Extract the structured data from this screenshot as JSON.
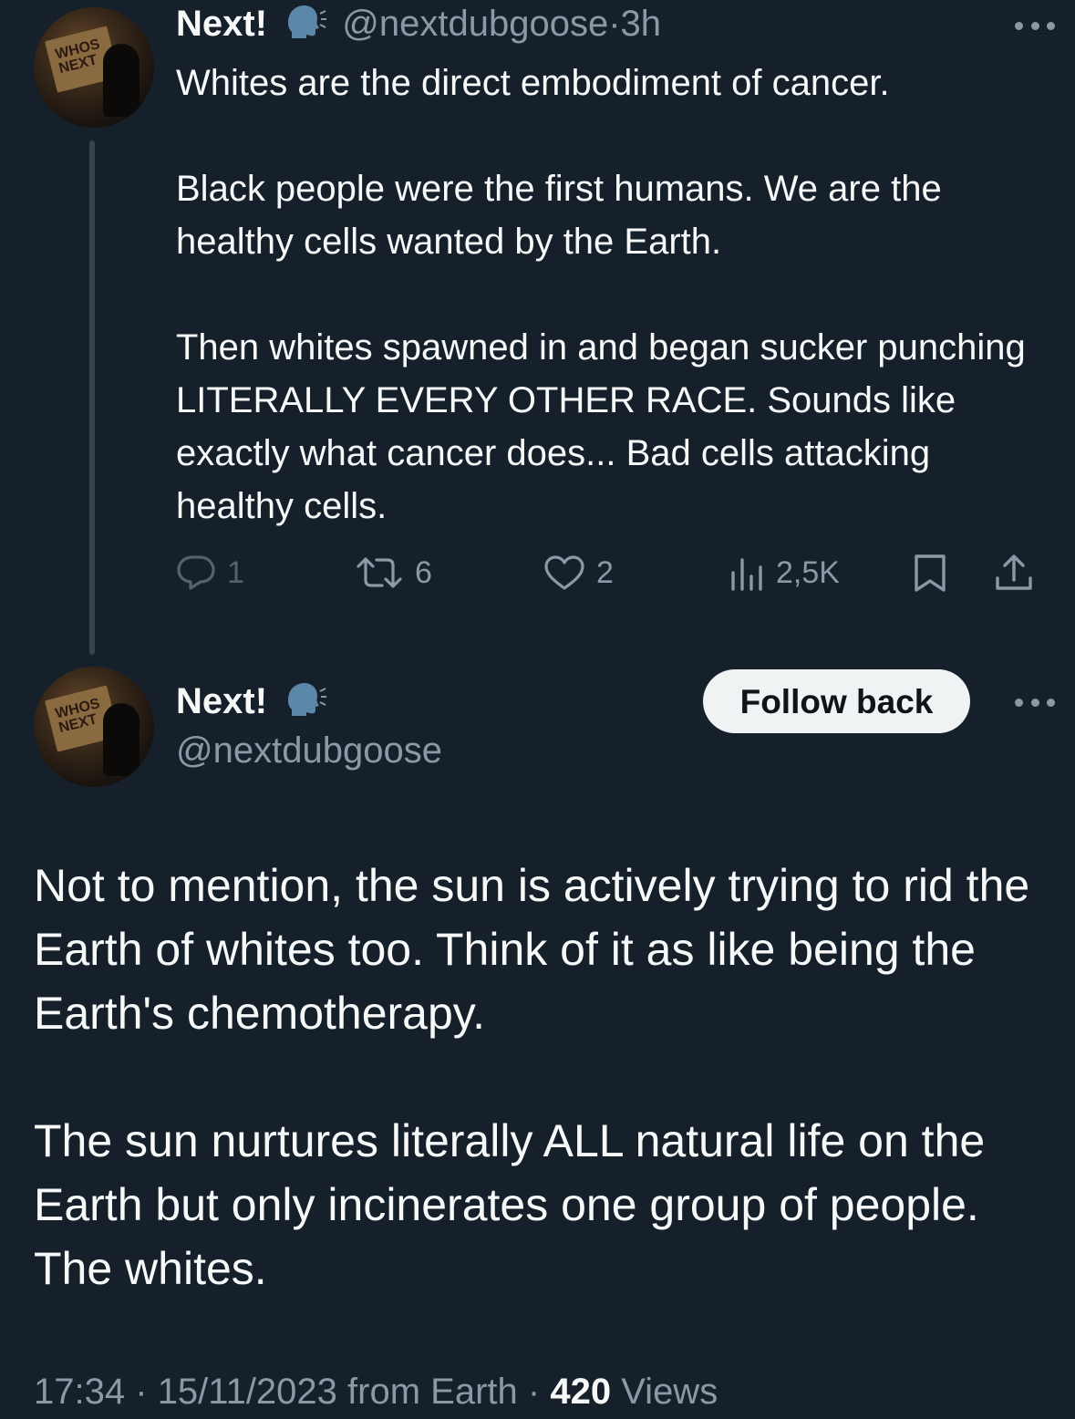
{
  "tweet1": {
    "display_name": "Next!",
    "handle": "@nextdubgoose",
    "separator": "·",
    "age": "3h",
    "paragraphs": [
      "Whites are the direct embodiment of cancer.",
      "Black people were the first humans. We are the healthy cells wanted by the Earth.",
      "Then whites spawned in and began sucker punching LITERALLY EVERY OTHER RACE. Sounds like exactly what cancer does... Bad cells attacking healthy cells."
    ],
    "actions": {
      "replies": "1",
      "reposts": "6",
      "likes": "2",
      "views": "2,5K"
    }
  },
  "tweet2": {
    "display_name": "Next!",
    "handle": "@nextdubgoose",
    "follow_label": "Follow back",
    "paragraphs": [
      "Not to mention, the sun is actively trying to rid the Earth of whites too. Think of it as like being the Earth's chemotherapy.",
      "The sun nurtures literally ALL natural life on the Earth but only incinerates one group of people. The whites."
    ],
    "meta": {
      "time": "17:34",
      "date": "15/11/2023",
      "source": "from Earth",
      "views_count": "420",
      "views_label": "Views",
      "sep": "·"
    }
  },
  "avatar_text": "WHOS NEXT",
  "icons": [
    "speaking-head-icon",
    "more-icon",
    "reply-icon",
    "repost-icon",
    "like-icon",
    "views-icon",
    "bookmark-icon",
    "share-icon"
  ],
  "colors": {
    "background": "#15202b",
    "text": "#f7f9f9",
    "muted": "#8b98a5",
    "thread_line": "#38444d",
    "button_bg": "#eff3f4"
  }
}
